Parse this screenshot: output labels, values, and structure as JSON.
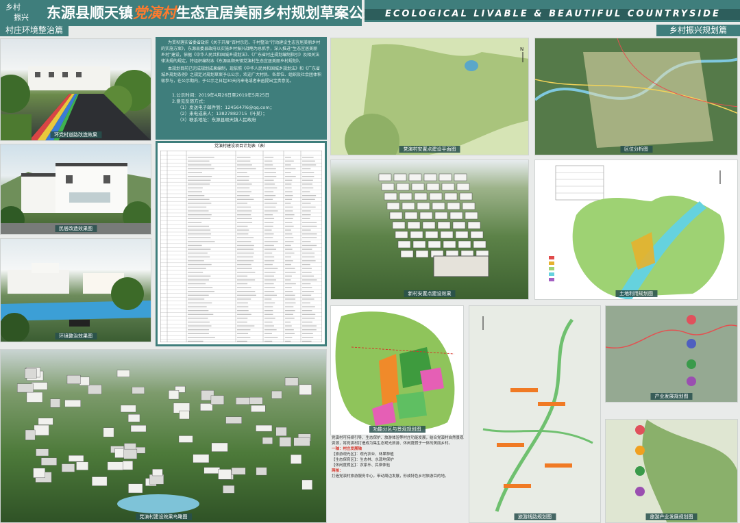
{
  "header": {
    "badge_line1": "乡村",
    "badge_line2": "振兴",
    "title_pre": "东源县顺天镇",
    "title_highlight": "党演村",
    "title_post": "生态宜居美丽乡村规划草案公示",
    "english": "ECOLOGICAL LIVABLE & BEAUTIFUL COUNTRYSIDE"
  },
  "sections": {
    "left": "村庄环境整治篇",
    "right": "乡村振兴规划篇"
  },
  "captions": {
    "road": "环党村道路改造效果",
    "houses": "民居改造效果图",
    "pool": "环境整治效果图",
    "aerial_main": "党演村建设效果鸟瞰图",
    "site_plan": "党演村安置点建设平面图",
    "region_map": "区位分析图",
    "aerial_new": "新村安置点建设效果",
    "landuse": "土地利用规划图",
    "zoning": "功能分区与景观规划图",
    "route": "旅游线路规划图",
    "industry1": "产业发展规划图",
    "industry2": "旅游产业发展规划图"
  },
  "intro": {
    "p1": "为贯彻落实省委省政府《关于开展“百村示范、千村整治”行动建设生态宜居美丽乡村的实施方案》，东源县委县政府以实施乡村振兴战略为总抓手，深入推进“生态宜居美丽乡村”建设，依据《中华人民共和国城乡规划法》、《广东省村庄规划编制指引》及相关法律法规的规定，特组织编制本《东源县顺天镇党演村生态宜居美丽乡村规划》。",
    "p2": "本规划目前已完成规划成果编制，现依照《中华人民共和国城乡规划法》和《广东省城乡规划条例》之规定对规划草案予以公示，欢迎广大村民、各单位、组织及社会团体积极参与，在公示期内，于公示之日起30天内来电或者来函提出宝贵意见。",
    "period": "1.公示时间：2019年4月26日至2019年5月25日",
    "methods_title": "2.意见反馈方式：",
    "m1": "（1）发送电子邮件到：1245647l6@qq.com；",
    "m2": "（2）来电或来人：13827882715（叶某）；",
    "m3": "（3）联系地址：东源县顺天镇人民政府"
  },
  "table": {
    "title": "党演村建设项目计划表（表）"
  },
  "zoning_text": {
    "t1": "党演村可持续引导、生态保护、旅游体验等村庄功能发展，结合党演村自然景观资源，将党演村打造成为集生态观光旅游、休闲度假于一体的美丽乡村。",
    "axis": "一轴：村庄发展轴",
    "t2": "【旅游观光区】：观光农业、林果种植",
    "t3": "【生态保育区】：生态林、水源地保护",
    "t4": "【休闲度假区】：农家乐、民宿体验",
    "core": "两核：",
    "t5": "打造党演村旅游服务中心，带动周边发展，形成特色乡村旅游目的地。"
  },
  "colors": {
    "teal": "#3f7e7c",
    "accent": "#ff7b2e"
  }
}
